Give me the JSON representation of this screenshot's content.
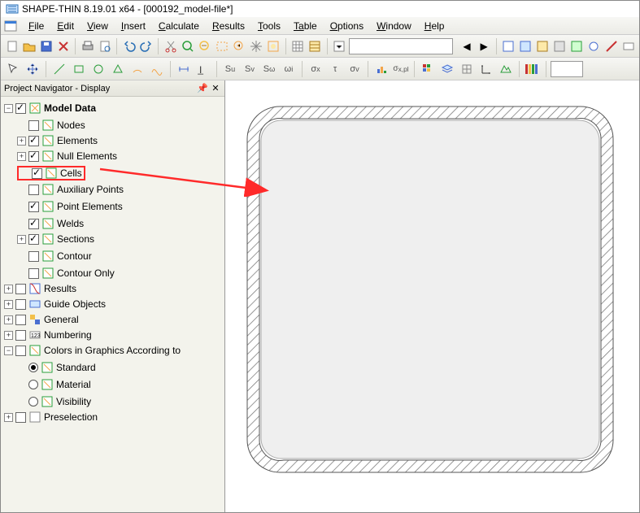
{
  "app": {
    "title": "SHAPE-THIN 8.19.01 x64 - [000192_model-file*]"
  },
  "menus": [
    "File",
    "Edit",
    "View",
    "Insert",
    "Calculate",
    "Results",
    "Tools",
    "Table",
    "Options",
    "Window",
    "Help"
  ],
  "panel": {
    "title": "Project Navigator - Display"
  },
  "tree": {
    "modelData": "Model Data",
    "nodes": "Nodes",
    "elements": "Elements",
    "nullElements": "Null Elements",
    "cells": "Cells",
    "auxPoints": "Auxiliary Points",
    "pointElements": "Point Elements",
    "welds": "Welds",
    "sections": "Sections",
    "contour": "Contour",
    "contourOnly": "Contour Only",
    "results": "Results",
    "guideObjects": "Guide Objects",
    "general": "General",
    "numbering": "Numbering",
    "colorsGraphics": "Colors in Graphics According to",
    "standard": "Standard",
    "material": "Material",
    "visibility": "Visibility",
    "preselection": "Preselection"
  }
}
